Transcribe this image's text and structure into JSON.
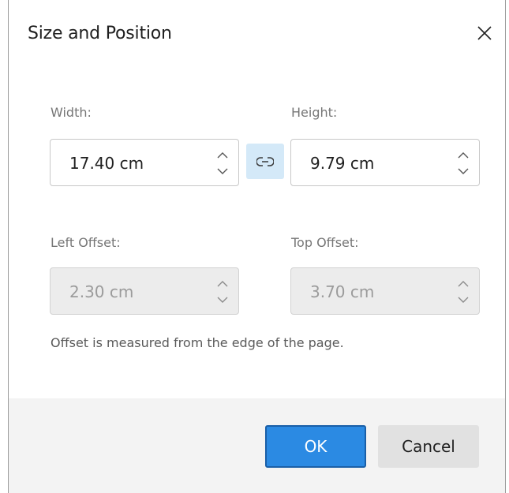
{
  "dialog": {
    "title": "Size and Position",
    "close_icon": "close-icon"
  },
  "width": {
    "label": "Width:",
    "value": "17.40 cm",
    "enabled": true
  },
  "height": {
    "label": "Height:",
    "value": "9.79 cm",
    "enabled": true
  },
  "link_toggle": {
    "icon": "link-icon",
    "active": true
  },
  "left_offset": {
    "label": "Left Offset:",
    "value": "2.30 cm",
    "enabled": false
  },
  "top_offset": {
    "label": "Top Offset:",
    "value": "3.70 cm",
    "enabled": false
  },
  "note": "Offset is measured from the edge of the page.",
  "buttons": {
    "ok": "OK",
    "cancel": "Cancel"
  },
  "colors": {
    "accent": "#2b8ae3",
    "link_toggle_bg": "#d4e9f8",
    "footer_bg": "#f3f3f3"
  }
}
